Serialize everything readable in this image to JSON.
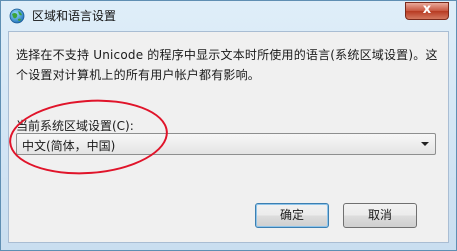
{
  "window": {
    "title": "区域和语言设置",
    "icon": "globe-icon",
    "close_glyph": "x"
  },
  "content": {
    "description_line1": "选择在不支持 Unicode 的程序中显示文本时所使用的语言(系统区域设置)。这",
    "description_line2": "个设置对计算机上的所有用户帐户都有影响。",
    "locale_label": "当前系统区域设置(C):",
    "locale_value": "中文(简体，中国)"
  },
  "buttons": {
    "ok_label": "确定",
    "cancel_label": "取消"
  },
  "annotation": {
    "color": "#e0142a"
  }
}
